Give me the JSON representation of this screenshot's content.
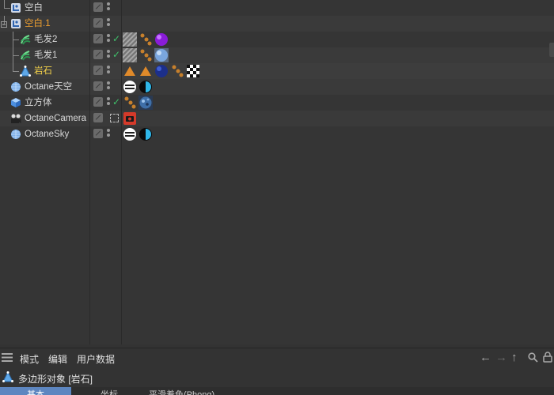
{
  "object_manager": {
    "objects": [
      {
        "name": "空白",
        "icon": "null-object-icon",
        "visible_check": false
      },
      {
        "name": "空白.1",
        "icon": "null-object-icon",
        "visible_check": false
      },
      {
        "name": "毛发2",
        "icon": "hair-icon",
        "visible_check": true
      },
      {
        "name": "毛发1",
        "icon": "hair-icon",
        "visible_check": true
      },
      {
        "name": "岩石",
        "icon": "polygon-object-icon",
        "visible_check": false
      },
      {
        "name": "Octane天空",
        "icon": "sky-icon",
        "visible_check": false
      },
      {
        "name": "立方体",
        "icon": "cube-icon",
        "visible_check": true
      },
      {
        "name": "OctaneCamera",
        "icon": "camera-icon",
        "visible_check": false
      },
      {
        "name": "OctaneSky",
        "icon": "sky-icon",
        "visible_check": false
      }
    ],
    "check_glyph": "✓"
  },
  "attribute_manager": {
    "menu": [
      "模式",
      "编辑",
      "用户数据"
    ],
    "object_title": "多边形对象 [岩石]",
    "tabs": [
      "基本",
      "坐标",
      "平滑着色(Phong)"
    ],
    "nav_icons": [
      "back-arrow-icon",
      "forward-arrow-icon",
      "up-arrow-icon",
      "search-icon",
      "lock-icon"
    ]
  },
  "colors": {
    "background": "#353535",
    "selected_name": "#f0a030",
    "active_name": "#f5d24a",
    "check_green": "#3fc06a",
    "active_tab": "#5d86c0"
  }
}
